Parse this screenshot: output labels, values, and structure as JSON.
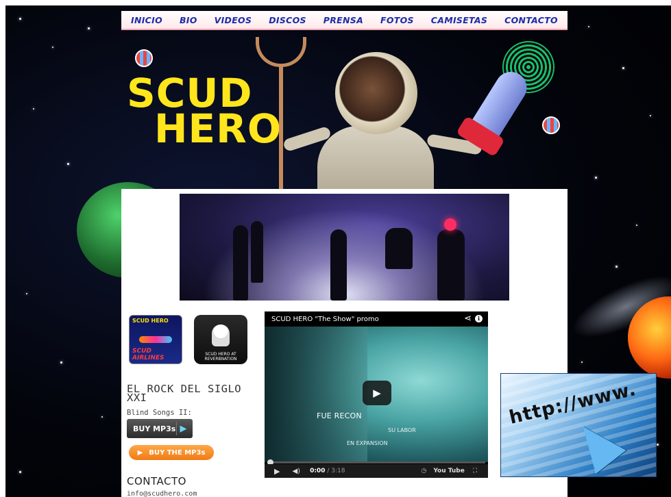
{
  "nav": {
    "items": [
      "INICIO",
      "BIO",
      "VIDEOS",
      "DISCOS",
      "PRENSA",
      "FOTOS",
      "CAMISETAS",
      "CONTACTO"
    ]
  },
  "header": {
    "logo_line1": "SCUD",
    "logo_line2": "HERO"
  },
  "sidebar": {
    "thumb_airlines_top": "SCUD HERO",
    "thumb_airlines_bottom": "SCUD AIRLINES",
    "thumb_reverb_caption": "SCUD HERO AT REVERBNATION",
    "rock_title_line1": "EL ROCK DEL SIGLO",
    "rock_title_line2": "XXI",
    "blind_songs_label": "Blind Songs II:",
    "buy_mp3_label": "BUY MP3s",
    "buy_the_mp3s_label": "BUY THE MP3s",
    "contacto_title": "CONTACTO",
    "email": "info@scudhero.com"
  },
  "video": {
    "title": "SCUD HERO \"The Show\" promo",
    "overlay_text": "FUE RECON",
    "overlay_sub1": "SU LABOR",
    "overlay_sub2": "EN EXPANSION",
    "current_time": "0:00",
    "duration": "3:18",
    "youtube_label": "You Tube",
    "progress": 0
  },
  "http_image": {
    "text": "http://www."
  },
  "colors": {
    "nav_text": "#1a2ca8",
    "logo": "#ffe61c",
    "buy_button_orange": "#f07b13"
  }
}
